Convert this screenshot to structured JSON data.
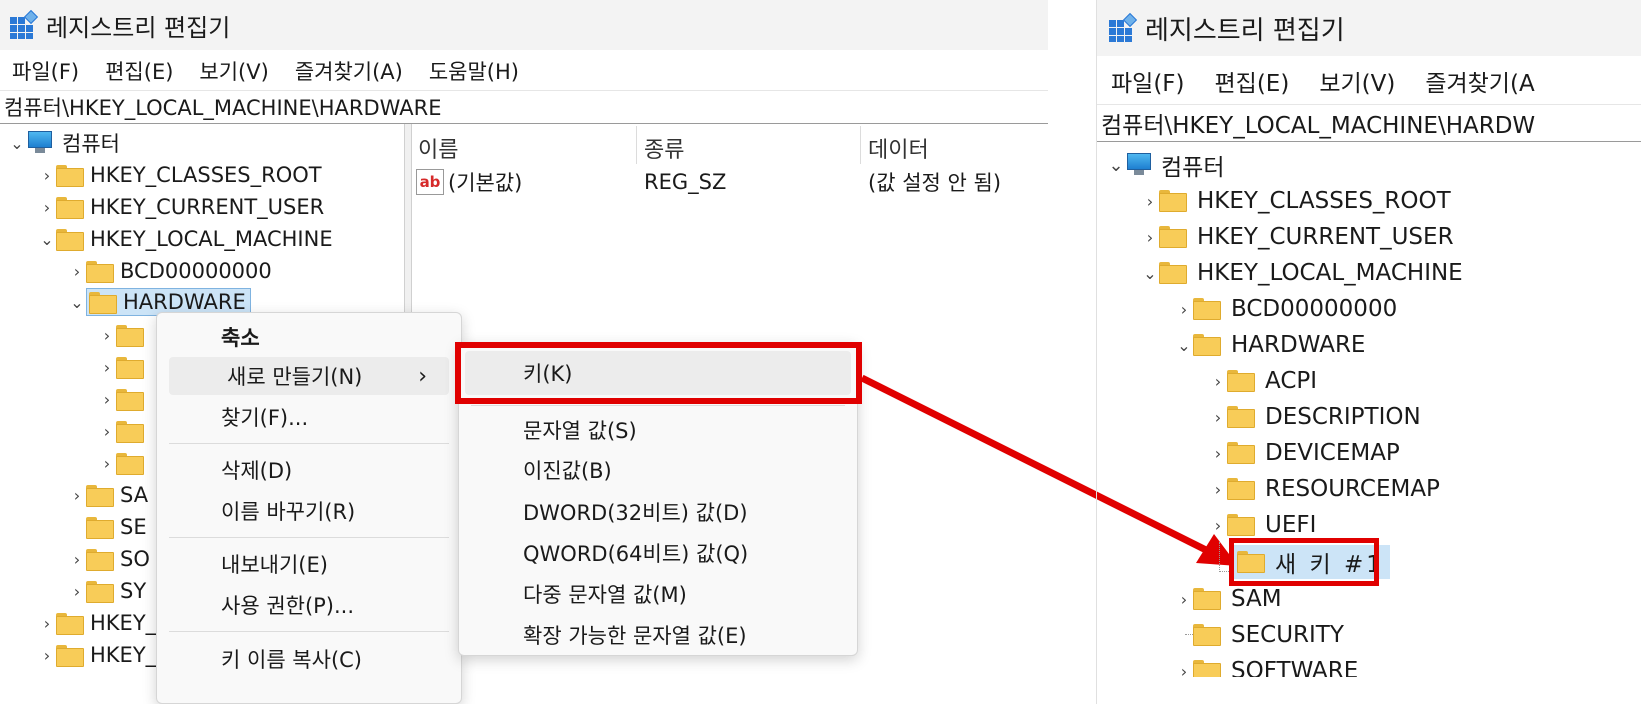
{
  "left": {
    "title": "레지스트리 편집기",
    "menu": [
      "파일(F)",
      "편집(E)",
      "보기(V)",
      "즐겨찾기(A)",
      "도움말(H)"
    ],
    "address": "컴퓨터\\HKEY_LOCAL_MACHINE\\HARDWARE",
    "tree": {
      "root": "컴퓨터",
      "items": [
        "HKEY_CLASSES_ROOT",
        "HKEY_CURRENT_USER",
        "HKEY_LOCAL_MACHINE",
        "BCD00000000",
        "HARDWARE"
      ],
      "partial": [
        "SA",
        "SE",
        "SO",
        "SY",
        "HKEY_",
        "HKEY_"
      ]
    },
    "columns": {
      "name": "이름",
      "type": "종류",
      "data": "데이터"
    },
    "value_row": {
      "name": "(기본값)",
      "type": "REG_SZ",
      "data": "(값 설정 안 됨)",
      "icon_text": "ab"
    },
    "context_menu": {
      "items": [
        "축소",
        "새로 만들기(N)",
        "찾기(F)...",
        "삭제(D)",
        "이름 바꾸기(R)",
        "내보내기(E)",
        "사용 권한(P)...",
        "키 이름 복사(C)"
      ],
      "submenu_arrow": "›"
    },
    "submenu": [
      "키(K)",
      "문자열 값(S)",
      "이진값(B)",
      "DWORD(32비트) 값(D)",
      "QWORD(64비트) 값(Q)",
      "다중 문자열 값(M)",
      "확장 가능한 문자열 값(E)"
    ]
  },
  "right": {
    "title": "레지스트리 편집기",
    "menu": [
      "파일(F)",
      "편집(E)",
      "보기(V)",
      "즐겨찾기(A"
    ],
    "address": "컴퓨터\\HKEY_LOCAL_MACHINE\\HARDW",
    "tree": {
      "root": "컴퓨터",
      "items": [
        "HKEY_CLASSES_ROOT",
        "HKEY_CURRENT_USER",
        "HKEY_LOCAL_MACHINE",
        "BCD00000000",
        "HARDWARE",
        "ACPI",
        "DESCRIPTION",
        "DEVICEMAP",
        "RESOURCEMAP",
        "UEFI",
        "새 키 #1",
        "SAM",
        "SECURITY",
        "SOFTWARE"
      ]
    }
  },
  "colors": {
    "highlight": "#e00000",
    "folder": "#f8cc58",
    "selection": "#cce4f7"
  }
}
